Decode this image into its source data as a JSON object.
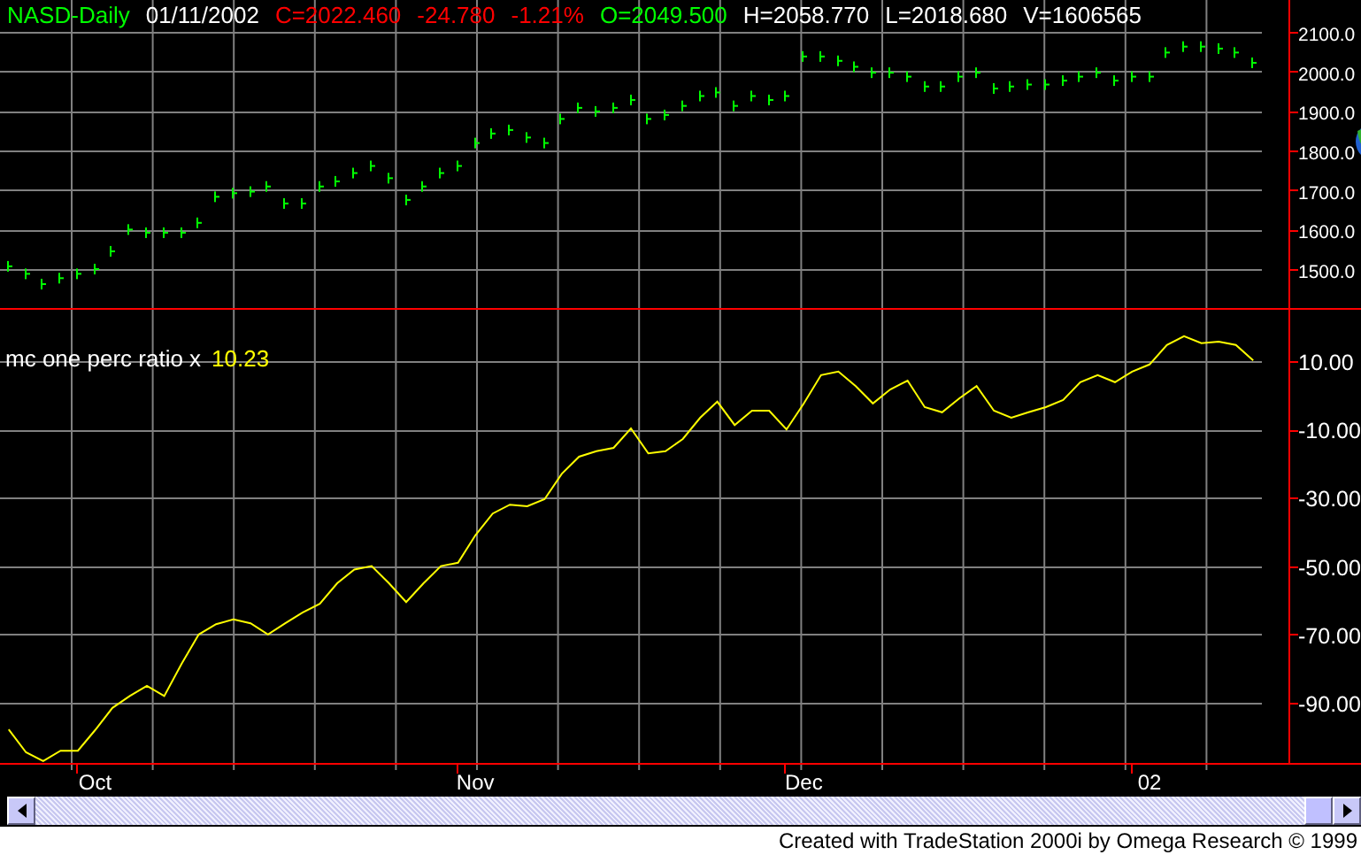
{
  "header": {
    "items": [
      {
        "text": "NASD-Daily",
        "color": "#00ff00"
      },
      {
        "text": "01/11/2002",
        "color": "#ffffff"
      },
      {
        "text": "C=2022.460",
        "color": "#ff0000"
      },
      {
        "text": "-24.780",
        "color": "#ff0000"
      },
      {
        "text": "-1.21%",
        "color": "#ff0000"
      },
      {
        "text": "O=2049.500",
        "color": "#00ff00"
      },
      {
        "text": "H=2058.770",
        "color": "#ffffff"
      },
      {
        "text": "L=2018.680",
        "color": "#ffffff"
      },
      {
        "text": "V=1606565",
        "color": "#ffffff"
      }
    ]
  },
  "price_panel": {
    "chart_data": {
      "type": "scatter",
      "ylim": [
        1397,
        2181
      ],
      "grid": true,
      "categories": [
        null,
        null,
        null,
        null,
        null,
        null,
        null,
        null,
        null,
        null,
        null,
        null,
        null,
        null,
        null,
        null,
        null,
        null,
        null,
        null,
        null,
        null,
        null,
        null,
        null,
        null,
        null,
        null,
        null,
        null,
        null,
        null,
        null,
        null,
        null,
        null,
        null,
        null,
        null,
        null,
        null,
        null,
        null,
        null,
        null,
        null,
        null,
        null,
        null,
        null,
        null,
        null,
        null,
        null,
        null,
        null,
        null,
        null,
        null,
        null,
        null,
        null,
        null,
        null,
        null,
        null,
        null,
        null,
        null,
        null,
        null,
        null,
        null
      ],
      "series": [
        {
          "color": "#00ff00",
          "values": [
            1507,
            1488,
            1462,
            1477,
            1488,
            1500,
            1545,
            1600,
            1592,
            1592,
            1592,
            1617,
            1683,
            1692,
            1696,
            1709,
            1666,
            1666,
            1709,
            1722,
            1743,
            1761,
            1730,
            1675,
            1709,
            1743,
            1761,
            1819,
            1843,
            1852,
            1833,
            1819,
            1880,
            1908,
            1899,
            1908,
            1928,
            1880,
            1890,
            1913,
            1938,
            1947,
            1913,
            1938,
            1928,
            1938,
            2038,
            2038,
            2027,
            2012,
            1997,
            1997,
            1987,
            1962,
            1962,
            1987,
            1997,
            1957,
            1962,
            1967,
            1967,
            1977,
            1987,
            1997,
            1977,
            1987,
            1987,
            2048,
            2063,
            2063,
            2058,
            2048,
            2022
          ]
        }
      ],
      "yticks": [
        {
          "value": 2100,
          "label": "2100.0"
        },
        {
          "value": 2000,
          "label": "2000.0"
        },
        {
          "value": 1900,
          "label": "1900.0"
        },
        {
          "value": 1800,
          "label": "1800.0"
        },
        {
          "value": 1700,
          "label": "1700.0"
        },
        {
          "value": 1600,
          "label": "1600.0"
        },
        {
          "value": 1500,
          "label": "1500.0"
        }
      ]
    }
  },
  "indicator_panel": {
    "legend": {
      "name": "mc one perc ratio x",
      "reading": "10.23"
    },
    "chart_data": {
      "type": "line",
      "ylim": [
        -108.1,
        25
      ],
      "grid": true,
      "categories": [
        null,
        null,
        null,
        null,
        null,
        "Oct",
        null,
        null,
        null,
        null,
        null,
        null,
        null,
        null,
        null,
        null,
        null,
        null,
        null,
        null,
        null,
        null,
        null,
        null,
        null,
        null,
        null,
        "Nov",
        null,
        null,
        null,
        null,
        null,
        null,
        null,
        null,
        null,
        null,
        null,
        null,
        null,
        null,
        null,
        null,
        null,
        null,
        "Dec",
        null,
        null,
        null,
        null,
        null,
        null,
        null,
        null,
        null,
        null,
        null,
        null,
        null,
        null,
        null,
        null,
        null,
        null,
        null,
        "02",
        null,
        null,
        null,
        null,
        null,
        null
      ],
      "series": [
        {
          "color": "#ffff00",
          "values": [
            -97.8,
            -104.5,
            -107,
            -104,
            -104,
            -98,
            -91.5,
            -88,
            -85,
            -88,
            -78.6,
            -70,
            -67,
            -65.6,
            -66.7,
            -70,
            -66.7,
            -63.6,
            -61,
            -55,
            -51,
            -50,
            -55,
            -60.5,
            -55,
            -50,
            -49,
            -41,
            -34.6,
            -32,
            -32.5,
            -30.4,
            -23,
            -18,
            -16.4,
            -15.4,
            -9.7,
            -17,
            -16.4,
            -12.8,
            -6.6,
            -1.9,
            -8.7,
            -4.5,
            -4.5,
            -10,
            -2.4,
            5.9,
            6.9,
            2.7,
            -2.4,
            1.7,
            4.3,
            -3.5,
            -5,
            -0.9,
            2.7,
            -4.5,
            -6.6,
            -5,
            -3.5,
            -1.4,
            3.8,
            5.9,
            3.8,
            6.9,
            9,
            14.7,
            17.3,
            15.2,
            15.7,
            14.7,
            10.2
          ]
        }
      ],
      "yticks": [
        {
          "value": 10,
          "label": "10.00"
        },
        {
          "value": -10,
          "label": "-10.00"
        },
        {
          "value": -30,
          "label": "-30.00"
        },
        {
          "value": -50,
          "label": "-50.00"
        },
        {
          "value": -70,
          "label": "-70.00"
        },
        {
          "value": -90,
          "label": "-90.00"
        }
      ]
    }
  },
  "footer": {
    "text": "Created with TradeStation 2000i by Omega Research © 1999"
  }
}
